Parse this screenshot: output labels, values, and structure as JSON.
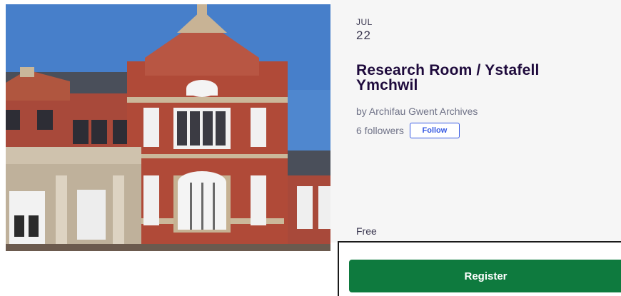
{
  "hero": {
    "image_alt": "event-building-photo"
  },
  "event": {
    "month": "JUL",
    "day": "22",
    "title": "Research Room / Ystafell Ymchwil",
    "organizer": "by Archifau Gwent Archives",
    "followers": "6 followers",
    "follow_label": "Follow",
    "price": "Free"
  },
  "cta": {
    "register_label": "Register"
  },
  "colors": {
    "accent_blue": "#3659e3",
    "register_green": "#0e7a3e",
    "title": "#1e0a3c",
    "panel_bg": "#f6f6f6"
  }
}
